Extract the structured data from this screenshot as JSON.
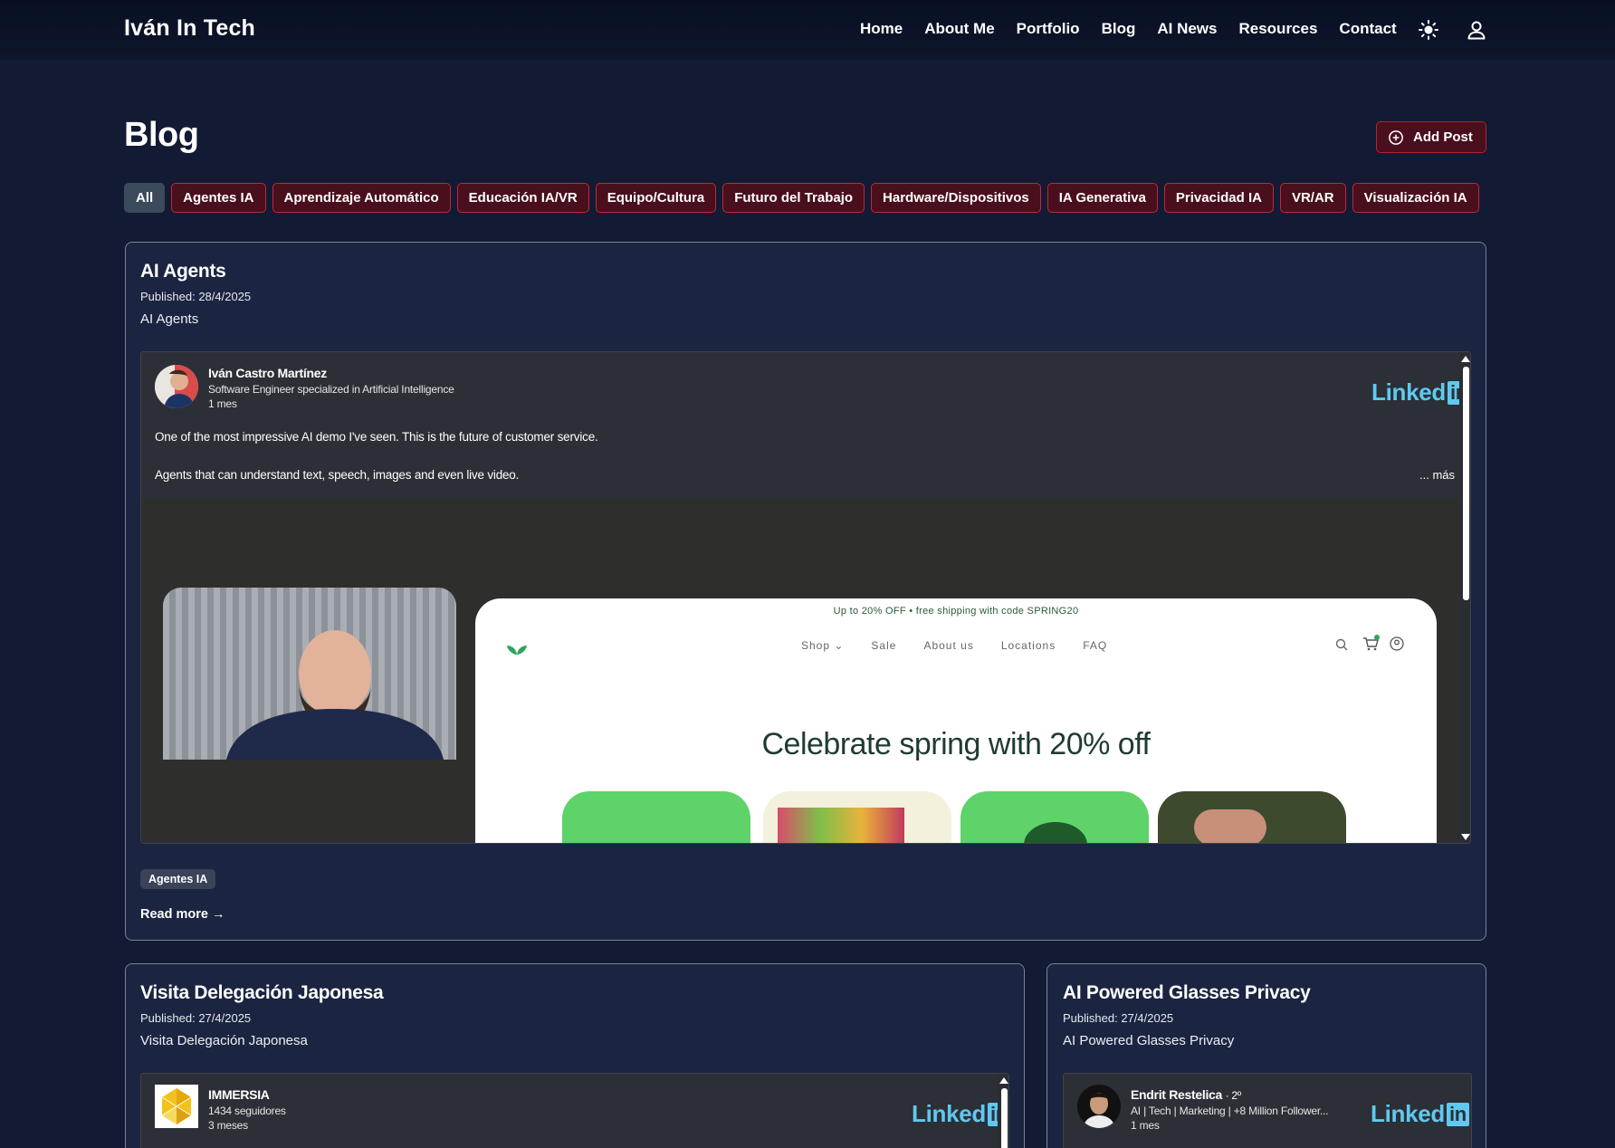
{
  "brand": "Iván In Tech",
  "nav": [
    "Home",
    "About Me",
    "Portfolio",
    "Blog",
    "AI News",
    "Resources",
    "Contact"
  ],
  "icons": {
    "theme": "sun-icon",
    "user": "user-icon",
    "add": "plus-circle-icon"
  },
  "page": {
    "title": "Blog",
    "add_post": "Add Post"
  },
  "filters": [
    "All",
    "Agentes IA",
    "Aprendizaje Automático",
    "Educación IA/VR",
    "Equipo/Cultura",
    "Futuro del Trabajo",
    "Hardware/Dispositivos",
    "IA Generativa",
    "Privacidad IA",
    "VR/AR",
    "Visualización IA"
  ],
  "posts": [
    {
      "title": "AI Agents",
      "published": "Published: 28/4/2025",
      "subtitle": "AI Agents",
      "embed": {
        "author": "Iván Castro Martínez",
        "headline": "Software Engineer specialized in Artificial Intelligence",
        "time": "1 mes",
        "logo": "Linked",
        "logo_in": "in",
        "text1": "One of the most impressive AI demo I've seen. This is the future of customer service.",
        "text2": "Agents that can understand text, speech, images and even live video.",
        "more": "... más",
        "video": {
          "promo": "Up to 20% OFF • free shipping with code SPRING20",
          "nav": [
            "Shop ⌄",
            "Sale",
            "About us",
            "Locations",
            "FAQ"
          ],
          "headline": "Celebrate spring with 20% off"
        }
      },
      "tag": "Agentes IA",
      "read_more": "Read more →"
    },
    {
      "title": "Visita Delegación Japonesa",
      "published": "Published: 27/4/2025",
      "subtitle": "Visita Delegación Japonesa",
      "embed": {
        "author": "IMMERSIA",
        "headline": "1434 seguidores",
        "time": "3 meses",
        "logo": "Linked",
        "logo_in": "in"
      }
    },
    {
      "title": "AI Powered Glasses Privacy",
      "published": "Published: 27/4/2025",
      "subtitle": "AI Powered Glasses Privacy",
      "embed": {
        "author": "Endrit Restelica",
        "degree": "· 2º",
        "headline": "AI | Tech | Marketing | +8 Million Follower...",
        "time": "1 mes",
        "logo": "Linked",
        "logo_in": "in"
      }
    }
  ],
  "colors": {
    "background": "#131a33",
    "nav_bg": "#091024",
    "accent": "#c0283a",
    "card_bg": "#1b2440",
    "linkedin": "#5fc9f0"
  }
}
